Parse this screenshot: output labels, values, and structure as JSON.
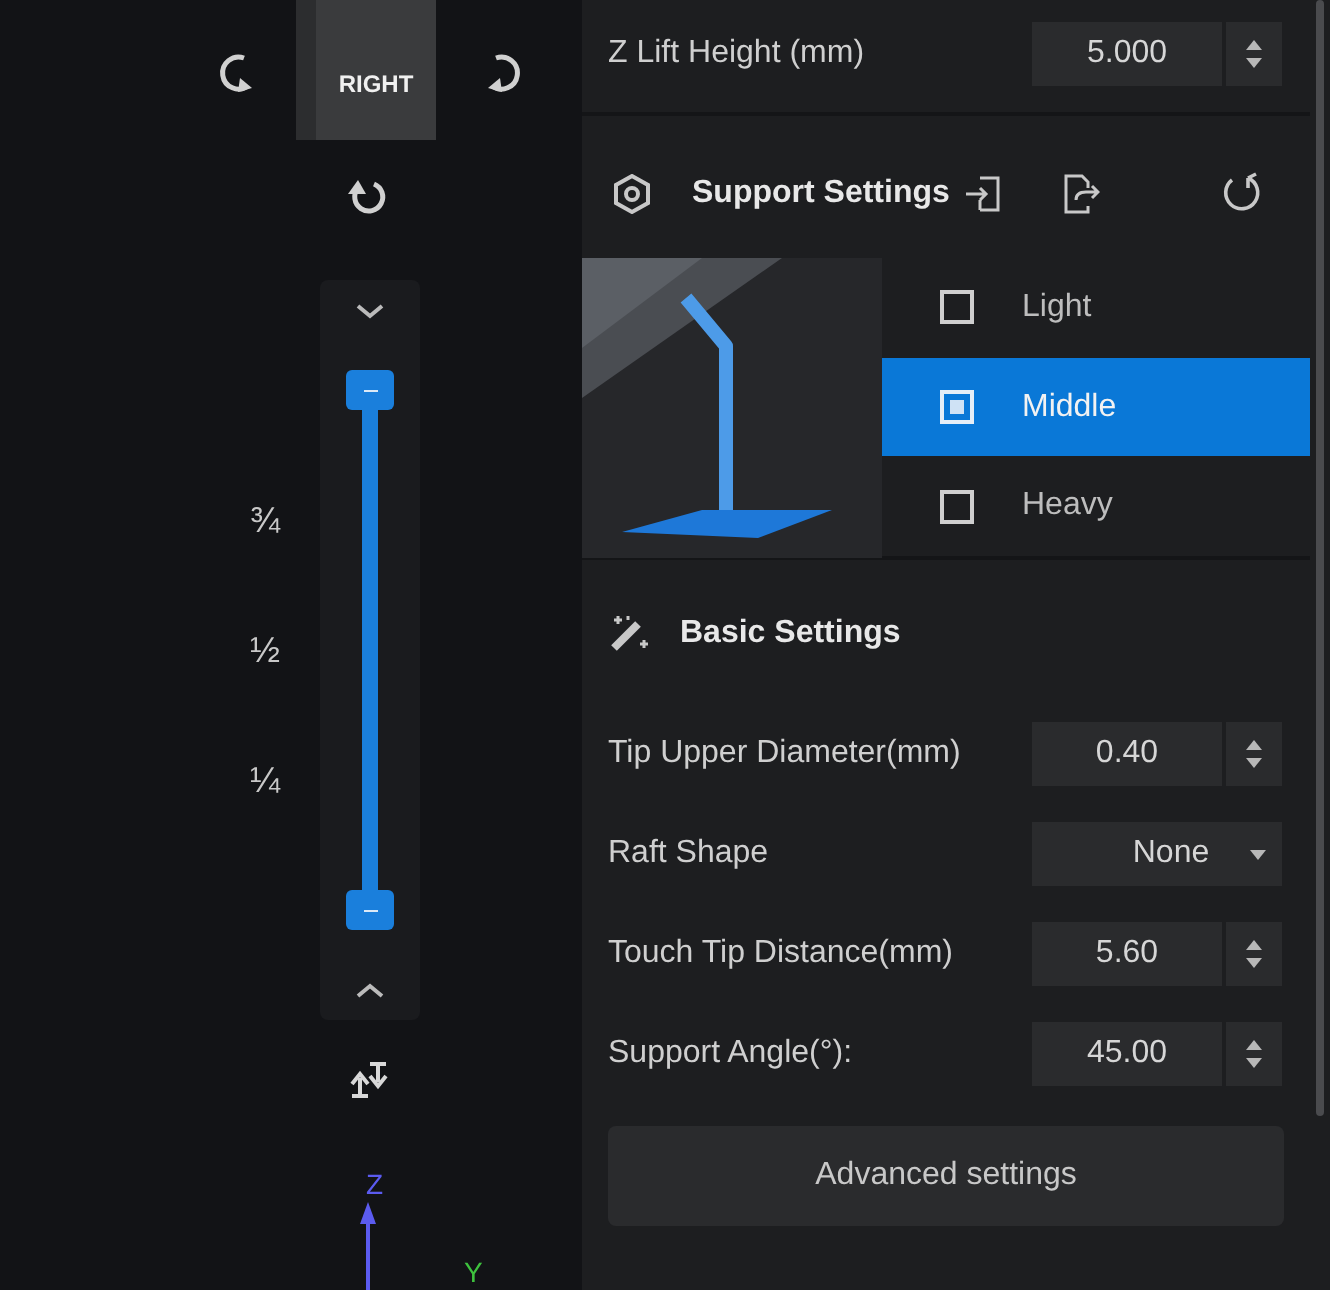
{
  "view_cube": {
    "face_label": "RIGHT"
  },
  "layer_slider": {
    "level": 1,
    "tick_labels": [
      "¾",
      "½",
      "¼"
    ]
  },
  "axis": {
    "z_label": "Z",
    "y_label": "Y"
  },
  "z_lift": {
    "label": "Z Lift Height (mm)",
    "value": "5.000"
  },
  "support_settings": {
    "title": "Support Settings",
    "options": [
      {
        "label": "Light",
        "selected": false
      },
      {
        "label": "Middle",
        "selected": true
      },
      {
        "label": "Heavy",
        "selected": false
      }
    ]
  },
  "basic_settings": {
    "title": "Basic Settings",
    "fields": [
      {
        "kind": "spin",
        "label": "Tip Upper Diameter(mm)",
        "value": "0.40"
      },
      {
        "kind": "dropdown",
        "label": "Raft Shape",
        "value": "None"
      },
      {
        "kind": "spin",
        "label": "Touch Tip Distance(mm)",
        "value": "5.60"
      },
      {
        "kind": "spin",
        "label": "Support Angle(°):",
        "value": "45.00"
      }
    ]
  },
  "advanced_button": "Advanced settings"
}
